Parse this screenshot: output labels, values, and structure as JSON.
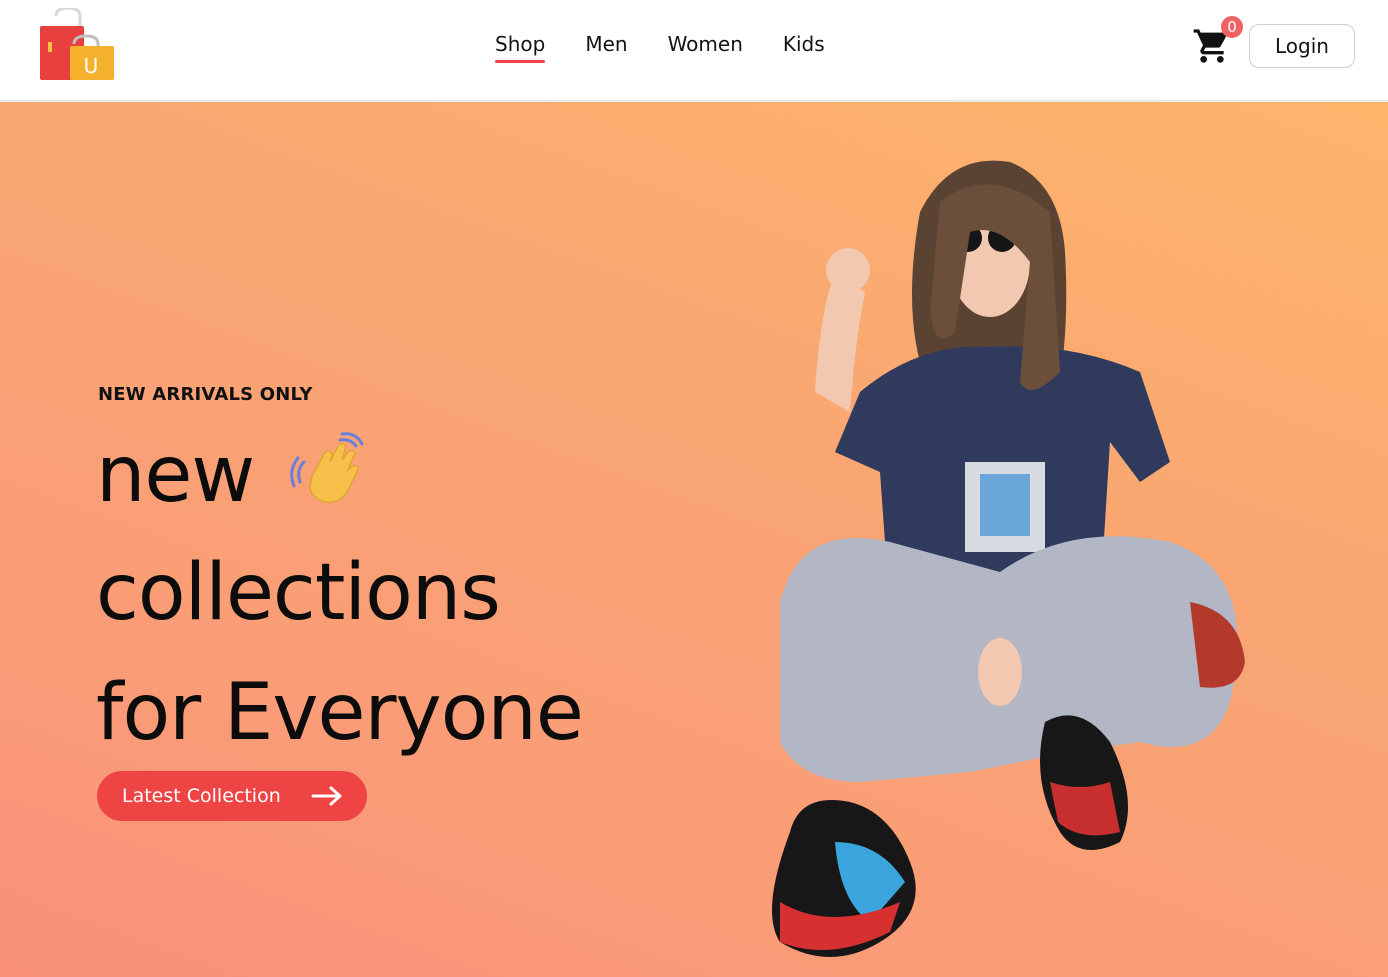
{
  "header": {
    "logo_icon": "shopping-bags-logo-icon",
    "logo_letter": "U",
    "nav": [
      {
        "label": "Shop",
        "active": true
      },
      {
        "label": "Men",
        "active": false
      },
      {
        "label": "Women",
        "active": false
      },
      {
        "label": "Kids",
        "active": false
      }
    ],
    "cart_icon": "shopping-cart-icon",
    "cart_count": "0",
    "login_label": "Login"
  },
  "hero": {
    "eyebrow": "NEW ARRIVALS ONLY",
    "headline_line1": "new",
    "headline_line2": "collections",
    "headline_line3": "for Everyone",
    "wave_icon": "waving-hand-icon",
    "cta_label": "Latest Collection",
    "cta_icon": "arrow-right-icon",
    "image_icon": "model-sitting-photo"
  },
  "colors": {
    "accent": "#ef4444",
    "hero_gradient_start": "#fdb56b",
    "hero_gradient_end": "#f8907a",
    "text": "#0c0c0c"
  }
}
